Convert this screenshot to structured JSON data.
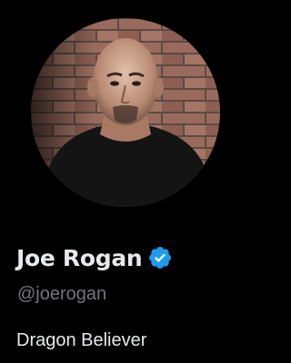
{
  "profile": {
    "display_name": "Joe Rogan",
    "handle": "@joerogan",
    "bio": "Dragon Believer",
    "verified": true,
    "avatar_icon": "profile-photo",
    "verified_icon": "verified-badge-icon"
  },
  "colors": {
    "background": "#000000",
    "primary_text": "#e7e9ea",
    "secondary_text": "#71767b",
    "verified_blue": "#1d9bf0"
  }
}
